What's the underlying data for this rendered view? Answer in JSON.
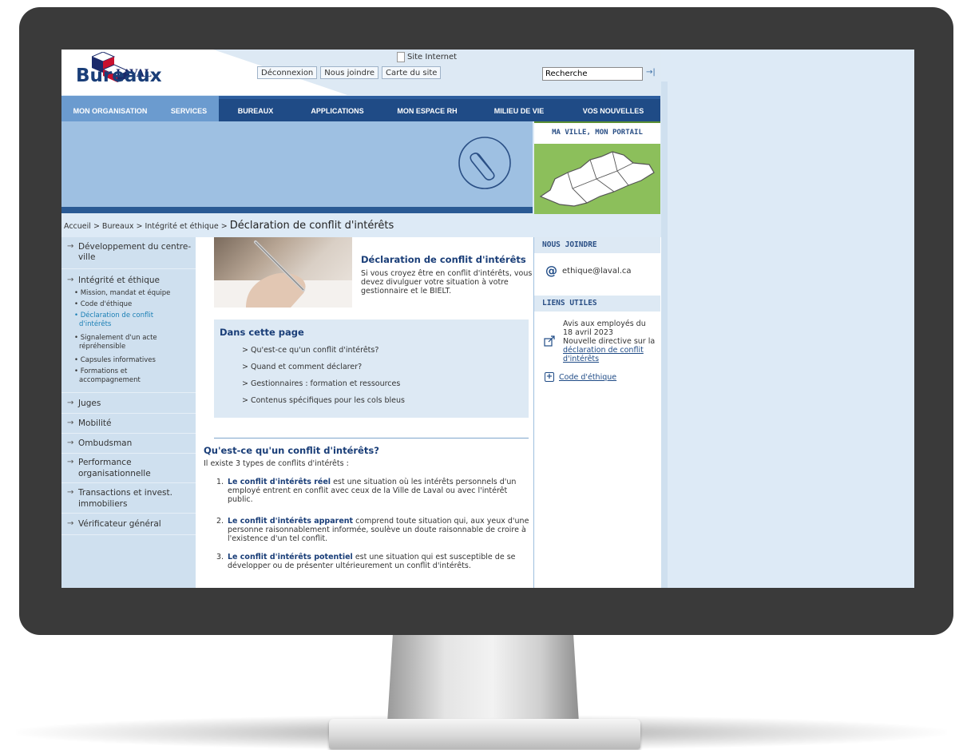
{
  "header": {
    "logo_text": "LAVAL",
    "site_internet": "Site Internet",
    "links": [
      "Déconnexion",
      "Nous joindre",
      "Carte du site"
    ],
    "search_value": "Recherche",
    "search_go": "→|"
  },
  "nav": [
    "MON ORGANISATION",
    "SERVICES",
    "BUREAUX",
    "APPLICATIONS",
    "MON ESPACE RH",
    "MILIEU DE VIE",
    "VOS NOUVELLES"
  ],
  "banner": {
    "title": "Bureaux",
    "portal_title": "MA VILLE, MON PORTAIL"
  },
  "breadcrumb": {
    "path": "Accueil > Bureaux > Intégrité et éthique >",
    "current": "Déclaration de conflit d'intérêts"
  },
  "menu": {
    "items": [
      {
        "label1": "Développement du centre-",
        "label2": "ville"
      },
      {
        "label1": "Intégrité et éthique",
        "label2": ""
      },
      {
        "label1": "Juges",
        "label2": ""
      },
      {
        "label1": "Mobilité",
        "label2": ""
      },
      {
        "label1": "Ombudsman",
        "label2": ""
      },
      {
        "label1": "Performance",
        "label2": "organisationnelle"
      },
      {
        "label1": "Transactions et invest.",
        "label2": "immobiliers"
      },
      {
        "label1": "Vérificateur général",
        "label2": ""
      }
    ],
    "arrow": "→",
    "sub": [
      {
        "l1": "• Mission, mandat et équipe",
        "l2": ""
      },
      {
        "l1": "• Code d'éthique",
        "l2": ""
      },
      {
        "l1": "• Déclaration de conflit",
        "l2": "d'intérêts"
      },
      {
        "l1": "• Signalement d'un acte",
        "l2": "répréhensible"
      },
      {
        "l1": "• Capsules informatives",
        "l2": ""
      },
      {
        "l1": "• Formations et",
        "l2": "accompagnement"
      }
    ]
  },
  "intro": {
    "title": "Déclaration de conflit d'intérêts",
    "text": "Si vous croyez être en conflit d'intérêts, vous devez divulguer votre situation à votre gestionnaire et le BIELT."
  },
  "toc": {
    "title": "Dans cette page",
    "items": [
      ">  Qu'est-ce qu'un conflit d'intérêts?",
      ">  Quand et comment déclarer?",
      ">  Gestionnaires  : formation et ressources",
      ">  Contenus spécifiques pour les cols bleus"
    ]
  },
  "section": {
    "title": "Qu'est-ce qu'un conflit d'intérêts?",
    "lead": "Il existe 3 types de conflits d'intérêts :",
    "items": [
      {
        "n": "1.",
        "bold": "Le conflit d'intérêts réel",
        "text": " est une situation où les intérêts personnels d'un employé entrent en conflit avec ceux de la Ville de Laval ou avec l'intérêt public."
      },
      {
        "n": "2.",
        "bold": "Le conflit d'intérêts apparent",
        "text": " comprend toute situation qui, aux yeux d'une personne raisonnablement informée, soulève un doute raisonnable de croire à l'existence d'un tel conflit."
      },
      {
        "n": "3.",
        "bold": "Le conflit d'intérêts potentiel",
        "text": " est une situation qui est susceptible de se développer ou de présenter ultérieurement un conflit d'intérêts."
      }
    ]
  },
  "right": {
    "contact_title": "NOUS JOINDRE",
    "email": "ethique@laval.ca",
    "at_symbol": "@",
    "links_title": "LIENS UTILES",
    "notice_l1": "Avis aux employés du",
    "notice_l2": "18 avril 2023",
    "notice_l3": "Nouvelle directive sur la",
    "notice_link1": "déclaration de conflit",
    "notice_link2": "d'intérêts",
    "code_link": "Code d'éthique",
    "plus": "+"
  },
  "colors": {
    "nav_dark": "#1f4b86",
    "nav_light": "#6b9bcf",
    "banner": "#9ec0e2",
    "heading": "#1a3e78",
    "active_link": "#1a7fb5",
    "bezel": "#3a3a3a"
  }
}
